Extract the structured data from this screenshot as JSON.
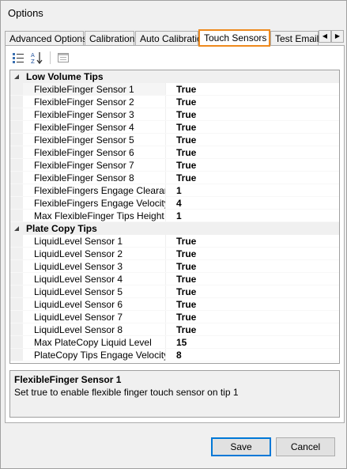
{
  "window": {
    "title": "Options"
  },
  "tabs": [
    {
      "label": "Advanced Options",
      "active": false
    },
    {
      "label": "Calibration",
      "active": false
    },
    {
      "label": "Auto Calibration",
      "active": false
    },
    {
      "label": "Touch Sensors",
      "active": true
    },
    {
      "label": "Test Email",
      "active": false
    }
  ],
  "tab_scroll": {
    "left": "◀",
    "right": "▶"
  },
  "toolbar": {
    "icons": [
      "categorized-icon",
      "alphabetical-icon",
      "property-pages-icon"
    ]
  },
  "property_grid": {
    "categories": [
      {
        "name": "Low Volume Tips",
        "items": [
          {
            "name": "FlexibleFinger Sensor 1",
            "value": "True",
            "selected": true
          },
          {
            "name": "FlexibleFinger Sensor 2",
            "value": "True"
          },
          {
            "name": "FlexibleFinger Sensor 3",
            "value": "True"
          },
          {
            "name": "FlexibleFinger Sensor 4",
            "value": "True"
          },
          {
            "name": "FlexibleFinger Sensor 5",
            "value": "True"
          },
          {
            "name": "FlexibleFinger Sensor 6",
            "value": "True"
          },
          {
            "name": "FlexibleFinger Sensor 7",
            "value": "True"
          },
          {
            "name": "FlexibleFinger Sensor 8",
            "value": "True"
          },
          {
            "name": "FlexibleFingers Engage Clearance",
            "value": "1"
          },
          {
            "name": "FlexibleFingers Engage Velocity",
            "value": "4"
          },
          {
            "name": "Max FlexibleFinger Tips Height Dif",
            "value": "1"
          }
        ]
      },
      {
        "name": "Plate Copy Tips",
        "items": [
          {
            "name": "LiquidLevel Sensor 1",
            "value": "True"
          },
          {
            "name": "LiquidLevel Sensor 2",
            "value": "True"
          },
          {
            "name": "LiquidLevel Sensor 3",
            "value": "True"
          },
          {
            "name": "LiquidLevel Sensor 4",
            "value": "True"
          },
          {
            "name": "LiquidLevel Sensor 5",
            "value": "True"
          },
          {
            "name": "LiquidLevel Sensor 6",
            "value": "True"
          },
          {
            "name": "LiquidLevel Sensor 7",
            "value": "True"
          },
          {
            "name": "LiquidLevel Sensor 8",
            "value": "True"
          },
          {
            "name": "Max PlateCopy Liquid Level",
            "value": "15"
          },
          {
            "name": "PlateCopy Tips Engage Velocity",
            "value": "8"
          }
        ]
      }
    ]
  },
  "description": {
    "title": "FlexibleFinger Sensor 1",
    "text": "Set true to enable flexible finger touch sensor on tip 1"
  },
  "buttons": {
    "save": "Save",
    "cancel": "Cancel"
  },
  "colors": {
    "active_tab_border": "#ee8a1e",
    "default_button_border": "#0078d7"
  }
}
